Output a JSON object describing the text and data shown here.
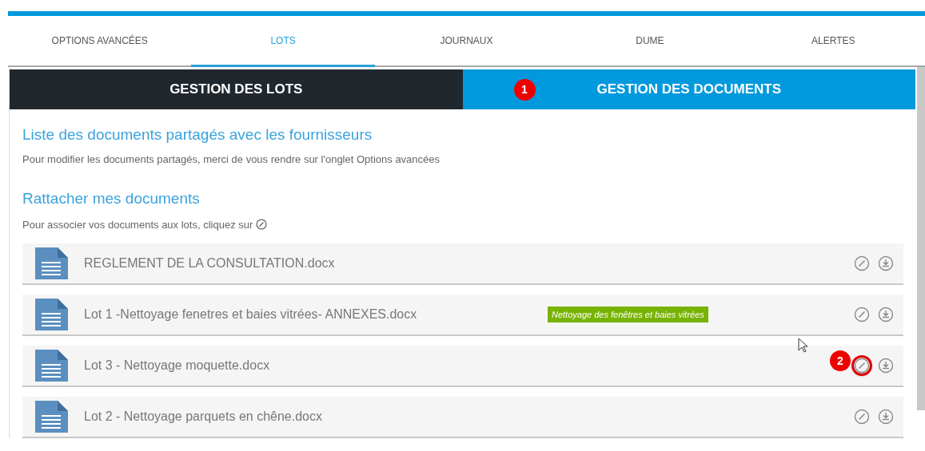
{
  "tabs": [
    {
      "label": "OPTIONS AVANCÉES",
      "selected": false
    },
    {
      "label": "LOTS",
      "selected": true
    },
    {
      "label": "JOURNAUX",
      "selected": false
    },
    {
      "label": "DUME",
      "selected": false
    },
    {
      "label": "ALERTES",
      "selected": false
    }
  ],
  "subtabs": [
    {
      "label": "GESTION DES LOTS",
      "selected": false
    },
    {
      "label": "GESTION DES DOCUMENTS",
      "selected": true,
      "badge": "1"
    }
  ],
  "shared_section": {
    "title": "Liste des documents partagés avec les fournisseurs",
    "note": "Pour modifier les documents partagés, merci de vous rendre sur l'onglet Options avancées"
  },
  "attach_section": {
    "title": "Rattacher mes documents",
    "note": "Pour associer vos documents aux lots, cliquez sur"
  },
  "documents": [
    {
      "name": "REGLEMENT DE LA CONSULTATION.docx",
      "highlighted": false
    },
    {
      "name": "Lot 1 -Nettoyage fenetres et baies vitrées- ANNEXES.docx",
      "tag": "Nettoyage des fenêtres et baies vitrées",
      "highlighted": false
    },
    {
      "name": "Lot 3 - Nettoyage moquette.docx",
      "highlighted": true,
      "badge": "2"
    },
    {
      "name": "Lot 2 - Nettoyage parquets en chêne.docx",
      "highlighted": false
    }
  ]
}
